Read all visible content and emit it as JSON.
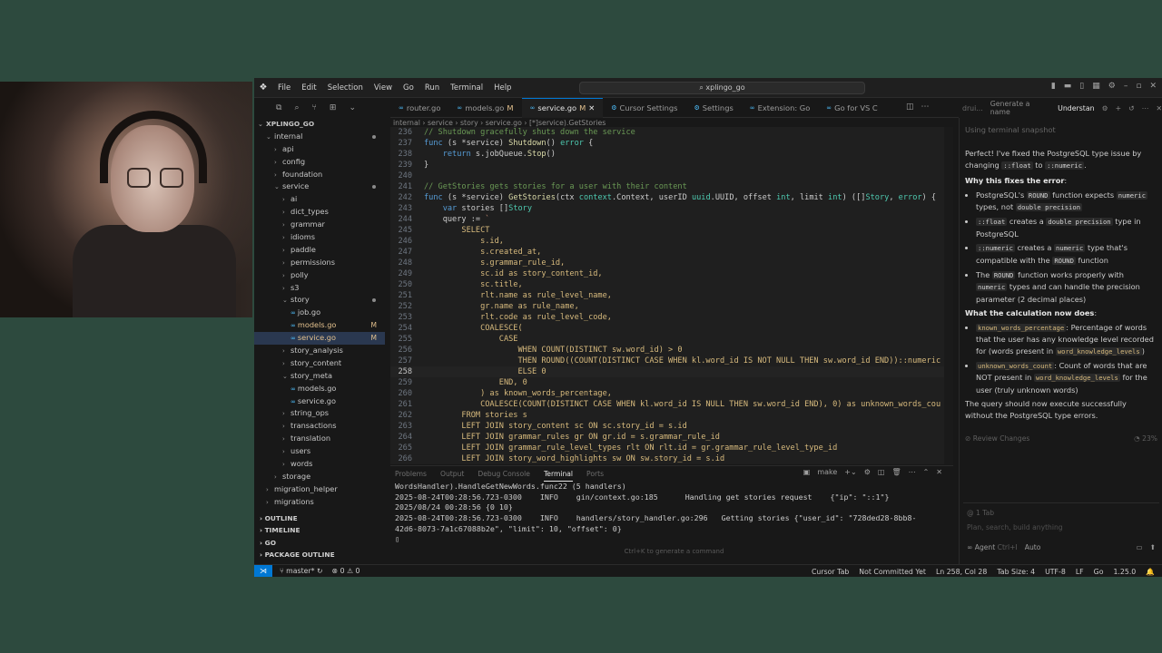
{
  "window": {
    "search_text": "xplingo_go",
    "menu": [
      "File",
      "Edit",
      "Selection",
      "View",
      "Go",
      "Run",
      "Terminal",
      "Help"
    ]
  },
  "tabs": [
    {
      "label": "router.go",
      "modified": "",
      "active": false
    },
    {
      "label": "models.go",
      "modified": "M",
      "active": false
    },
    {
      "label": "service.go",
      "modified": "M",
      "active": true
    },
    {
      "label": "Cursor Settings",
      "modified": "",
      "active": false
    },
    {
      "label": "Settings",
      "modified": "",
      "active": false
    },
    {
      "label": "Extension: Go",
      "modified": "",
      "active": false
    },
    {
      "label": "Go for VS C",
      "modified": "",
      "active": false
    }
  ],
  "breadcrumb": "internal › service › story › service.go › [*]service).GetStories",
  "explorer": {
    "root": "XPLINGO_GO",
    "items": [
      {
        "label": "internal",
        "depth": 1,
        "type": "folder-open",
        "dot": true
      },
      {
        "label": "api",
        "depth": 2,
        "type": "folder"
      },
      {
        "label": "config",
        "depth": 2,
        "type": "folder"
      },
      {
        "label": "foundation",
        "depth": 2,
        "type": "folder"
      },
      {
        "label": "service",
        "depth": 2,
        "type": "folder-open",
        "dot": true
      },
      {
        "label": "ai",
        "depth": 3,
        "type": "folder"
      },
      {
        "label": "dict_types",
        "depth": 3,
        "type": "folder"
      },
      {
        "label": "grammar",
        "depth": 3,
        "type": "folder"
      },
      {
        "label": "idioms",
        "depth": 3,
        "type": "folder"
      },
      {
        "label": "paddle",
        "depth": 3,
        "type": "folder"
      },
      {
        "label": "permissions",
        "depth": 3,
        "type": "folder"
      },
      {
        "label": "polly",
        "depth": 3,
        "type": "folder"
      },
      {
        "label": "s3",
        "depth": 3,
        "type": "folder"
      },
      {
        "label": "story",
        "depth": 3,
        "type": "folder-open",
        "dot": true
      },
      {
        "label": "job.go",
        "depth": 4,
        "type": "file"
      },
      {
        "label": "models.go",
        "depth": 4,
        "type": "file",
        "flag": "M"
      },
      {
        "label": "service.go",
        "depth": 4,
        "type": "file",
        "flag": "M",
        "selected": true
      },
      {
        "label": "story_analysis",
        "depth": 3,
        "type": "folder"
      },
      {
        "label": "story_content",
        "depth": 3,
        "type": "folder"
      },
      {
        "label": "story_meta",
        "depth": 3,
        "type": "folder-open"
      },
      {
        "label": "models.go",
        "depth": 4,
        "type": "file"
      },
      {
        "label": "service.go",
        "depth": 4,
        "type": "file"
      },
      {
        "label": "string_ops",
        "depth": 3,
        "type": "folder"
      },
      {
        "label": "transactions",
        "depth": 3,
        "type": "folder"
      },
      {
        "label": "translation",
        "depth": 3,
        "type": "folder"
      },
      {
        "label": "users",
        "depth": 3,
        "type": "folder"
      },
      {
        "label": "words",
        "depth": 3,
        "type": "folder"
      },
      {
        "label": "storage",
        "depth": 2,
        "type": "folder"
      },
      {
        "label": "migration_helper",
        "depth": 1,
        "type": "folder"
      },
      {
        "label": "migrations",
        "depth": 1,
        "type": "folder"
      }
    ],
    "sections": [
      "OUTLINE",
      "TIMELINE",
      "GO",
      "PACKAGE OUTLINE"
    ]
  },
  "editor": {
    "current_line": 258,
    "lines": [
      {
        "n": "236",
        "t": "// Shutdown gracefully shuts down the service",
        "k": "comment"
      },
      {
        "n": "237",
        "t": "func (s *service) Shutdown() error {",
        "k": "func"
      },
      {
        "n": "238",
        "t": "    return s.jobQueue.Stop()",
        "k": "plain"
      },
      {
        "n": "239",
        "t": "}",
        "k": "plain"
      },
      {
        "n": "240",
        "t": "",
        "k": "plain"
      },
      {
        "n": "241",
        "t": "// GetStories gets stories for a user with their content",
        "k": "comment"
      },
      {
        "n": "242",
        "t": "func (s *service) GetStories(ctx context.Context, userID uuid.UUID, offset int, limit int) ([]Story, error) {",
        "k": "func"
      },
      {
        "n": "243",
        "t": "    var stories []Story",
        "k": "plain"
      },
      {
        "n": "244",
        "t": "    query := `",
        "k": "plain"
      },
      {
        "n": "245",
        "t": "        SELECT",
        "k": "sql"
      },
      {
        "n": "246",
        "t": "            s.id,",
        "k": "sql"
      },
      {
        "n": "247",
        "t": "            s.created_at,",
        "k": "sql"
      },
      {
        "n": "248",
        "t": "            s.grammar_rule_id,",
        "k": "sql"
      },
      {
        "n": "249",
        "t": "            sc.id as story_content_id,",
        "k": "sql"
      },
      {
        "n": "250",
        "t": "            sc.title,",
        "k": "sql"
      },
      {
        "n": "251",
        "t": "            rlt.name as rule_level_name,",
        "k": "sql"
      },
      {
        "n": "252",
        "t": "            gr.name as rule_name,",
        "k": "sql"
      },
      {
        "n": "253",
        "t": "            rlt.code as rule_level_code,",
        "k": "sql"
      },
      {
        "n": "254",
        "t": "            COALESCE(",
        "k": "sql"
      },
      {
        "n": "255",
        "t": "                CASE",
        "k": "sql"
      },
      {
        "n": "256",
        "t": "                    WHEN COUNT(DISTINCT sw.word_id) > 0",
        "k": "sql"
      },
      {
        "n": "257",
        "t": "                    THEN ROUND((COUNT(DISTINCT CASE WHEN kl.word_id IS NOT NULL THEN sw.word_id END))::numeric",
        "k": "sql"
      },
      {
        "n": "258",
        "t": "                    ELSE 0",
        "k": "sql"
      },
      {
        "n": "259",
        "t": "                END, 0",
        "k": "sql"
      },
      {
        "n": "260",
        "t": "            ) as known_words_percentage,",
        "k": "sql"
      },
      {
        "n": "261",
        "t": "            COALESCE(COUNT(DISTINCT CASE WHEN kl.word_id IS NULL THEN sw.word_id END), 0) as unknown_words_cou",
        "k": "sql"
      },
      {
        "n": "262",
        "t": "        FROM stories s",
        "k": "sql"
      },
      {
        "n": "263",
        "t": "        LEFT JOIN story_content sc ON sc.story_id = s.id",
        "k": "sql"
      },
      {
        "n": "264",
        "t": "        LEFT JOIN grammar_rules gr ON gr.id = s.grammar_rule_id",
        "k": "sql"
      },
      {
        "n": "265",
        "t": "        LEFT JOIN grammar_rule_level_types rlt ON rlt.id = gr.grammar_rule_level_type_id",
        "k": "sql"
      },
      {
        "n": "266",
        "t": "        LEFT JOIN story_word_highlights sw ON sw.story_id = s.id",
        "k": "sql"
      }
    ]
  },
  "panel": {
    "tabs": [
      "Problems",
      "Output",
      "Debug Console",
      "Terminal",
      "Ports"
    ],
    "active_tab": "Terminal",
    "shell": "make",
    "lines": [
      "WordsHandler).HandleGetNewWords.func22 (5 handlers)",
      "2025-08-24T00:28:56.723-0300    INFO    gin/context.go:185      Handling get stories request    {\"ip\": \"::1\"}",
      "2025/08/24 00:28:56 {0 10}",
      "2025-08-24T00:28:56.723-0300    INFO    handlers/story_handler.go:296   Getting stories {\"user_id\": \"728ded28-8bb8-",
      "42d6-8073-7a1c67088b2e\", \"limit\": 10, \"offset\": 0}"
    ],
    "hint": "Ctrl+K to generate a command"
  },
  "chat": {
    "tabs": [
      "Generate a name",
      "Understan"
    ],
    "status": "Using terminal snapshot",
    "intro_1": "Perfect! I've fixed the PostgreSQL type issue by changing",
    "intro_code_1": "::float",
    "intro_2": "to",
    "intro_code_2": "::numeric",
    "why_heading": "Why this fixes the error",
    "why_items": [
      {
        "a": "PostgreSQL's ",
        "c1": "ROUND",
        "b": " function expects ",
        "c2": "numeric",
        "d": " types, not ",
        "c3": "double precision",
        "e": ""
      },
      {
        "a": "",
        "c1": "::float",
        "b": " creates a ",
        "c2": "double precision",
        "d": " type in PostgreSQL",
        "c3": "",
        "e": ""
      },
      {
        "a": "",
        "c1": "::numeric",
        "b": " creates a ",
        "c2": "numeric",
        "d": " type that's compatible with the ",
        "c3": "ROUND",
        "e": " function"
      },
      {
        "a": "The ",
        "c1": "ROUND",
        "b": " function works properly with ",
        "c2": "numeric",
        "d": " types and can handle the precision parameter (2 decimal places)",
        "c3": "",
        "e": ""
      }
    ],
    "calc_heading": "What the calculation now does",
    "calc_items": [
      {
        "c1": "known_words_percentage",
        "b": ": Percentage of words that the user has any knowledge level recorded for (words present in ",
        "c2": "word_knowledge_levels",
        "d": ")"
      },
      {
        "c1": "unknown_words_count",
        "b": ": Count of words that are NOT present in ",
        "c2": "word_knowledge_levels",
        "d": " for the user (truly unknown words)"
      }
    ],
    "closing": "The query should now execute successfully without the PostgreSQL type errors.",
    "review_label": "Review Changes",
    "review_pct": "23%",
    "attached": "1 Tab",
    "input_placeholder": "Plan, search, build anything",
    "agent_label": "Agent",
    "agent_shortcut": "Ctrl+I",
    "model": "Auto"
  },
  "statusbar": {
    "branch": "master*",
    "problems": "0",
    "warnings": "0",
    "right": [
      "Cursor Tab",
      "Not Committed Yet",
      "Ln 258, Col 28",
      "Tab Size: 4",
      "UTF-8",
      "LF",
      "Go",
      "1.25.0"
    ]
  }
}
